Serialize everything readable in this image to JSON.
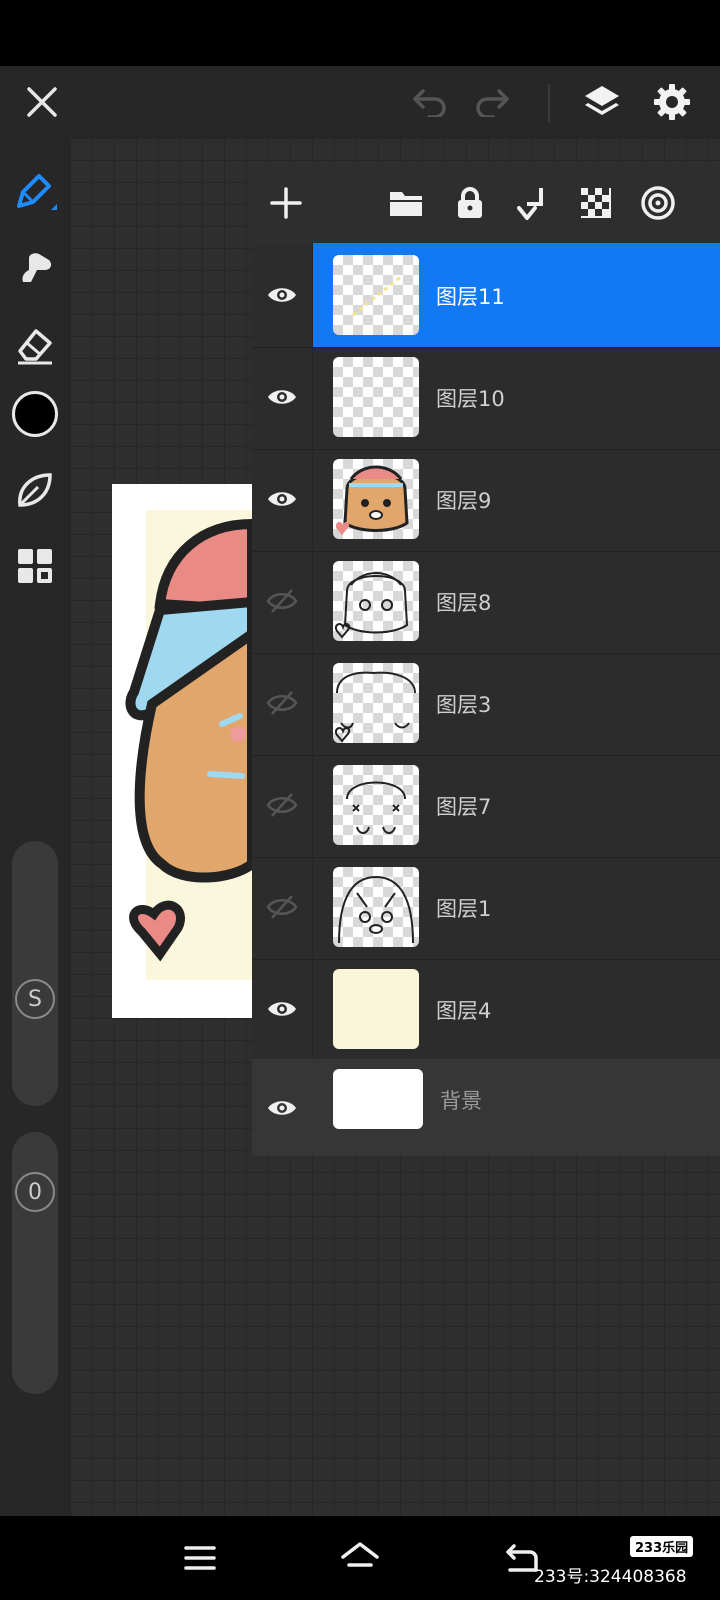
{
  "toolbar": {
    "close_icon": "close-icon",
    "undo_icon": "undo-icon",
    "redo_icon": "redo-icon",
    "layers_icon": "layers-icon",
    "settings_icon": "gear-icon"
  },
  "left_tools": {
    "items": [
      "pen-icon",
      "smudge-icon",
      "eraser-icon",
      "color-swatch",
      "leaf-icon",
      "grid-icon"
    ],
    "brush_size_knob": "S",
    "opacity_knob": "0",
    "current_color": "#000000"
  },
  "layer_panel": {
    "toolbar_icons": [
      "add-icon",
      "folder-icon",
      "lock-icon",
      "merge-down-icon",
      "checkerboard-icon",
      "target-icon"
    ],
    "layers": [
      {
        "name": "图层11",
        "visible": true,
        "selected": true
      },
      {
        "name": "图层10",
        "visible": true,
        "selected": false
      },
      {
        "name": "图层9",
        "visible": true,
        "selected": false
      },
      {
        "name": "图层8",
        "visible": false,
        "selected": false
      },
      {
        "name": "图层3",
        "visible": false,
        "selected": false
      },
      {
        "name": "图层7",
        "visible": false,
        "selected": false
      },
      {
        "name": "图层1",
        "visible": false,
        "selected": false
      },
      {
        "name": "图层4",
        "visible": true,
        "selected": false
      }
    ],
    "background_layer": {
      "name": "背景",
      "visible": true
    }
  },
  "navbar": {
    "menu_icon": "menu-icon",
    "home_icon": "home-icon",
    "back_icon": "back-icon"
  },
  "watermark": {
    "logo": "233乐园",
    "text": "233号:324408368"
  },
  "colors": {
    "accent": "#1279f3",
    "toolbar_bg": "#272727",
    "panel_bg": "#2c2c2c"
  }
}
